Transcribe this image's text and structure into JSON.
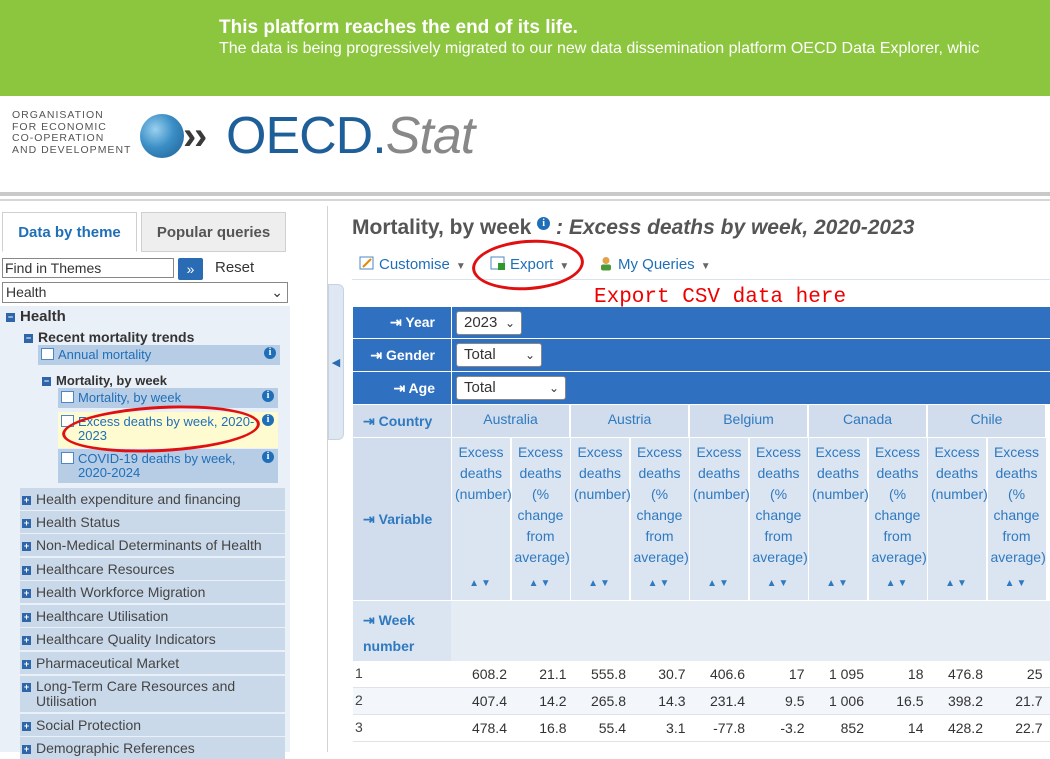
{
  "banner": {
    "title": "This platform reaches the end of its life.",
    "subtitle": "The data is being progressively migrated to our new data dissemination platform OECD Data Explorer, whic"
  },
  "header": {
    "org_lines": [
      "ORGANISATION",
      "FOR ECONOMIC",
      "CO-OPERATION",
      "AND DEVELOPMENT"
    ],
    "brand": "OECD",
    "brand_dot": ".",
    "brand_suffix": "Stat"
  },
  "left": {
    "tabs": [
      "Data by theme",
      "Popular queries"
    ],
    "find_value": "Find in Themes",
    "go_label": "»",
    "reset_label": "Reset",
    "theme_select": "Health",
    "tree": {
      "root": "Health",
      "group": "Recent mortality trends",
      "annual": "Annual mortality",
      "subgroup": "Mortality, by week",
      "items": [
        "Mortality, by week",
        "Excess deaths by week, 2020-2023",
        "COVID-19 deaths by week, 2020-2024"
      ],
      "categories": [
        "Health expenditure and financing",
        "Health Status",
        "Non-Medical Determinants of Health",
        "Healthcare Resources",
        "Health Workforce Migration",
        "Healthcare Utilisation",
        "Healthcare Quality Indicators",
        "Pharmaceutical Market",
        "Long-Term Care Resources and Utilisation",
        "Social Protection",
        "Demographic References"
      ]
    }
  },
  "main": {
    "title": "Mortality, by week",
    "subtitle": ": Excess deaths by week, 2020-2023",
    "toolbar": {
      "customise": "Customise",
      "export": "Export",
      "my_queries": "My Queries"
    },
    "annotation": "Export CSV data here",
    "dims": {
      "year_label": "Year",
      "year_value": "2023",
      "gender_label": "Gender",
      "gender_value": "Total",
      "age_label": "Age",
      "age_value": "Total",
      "country_label": "Country",
      "variable_label": "Variable",
      "week_label": "Week number"
    },
    "countries": [
      "Australia",
      "Austria",
      "Belgium",
      "Canada",
      "Chile"
    ],
    "variables": [
      "Excess deaths (number)",
      "Excess deaths (% change from average)"
    ],
    "rows": [
      {
        "week": "1",
        "values": [
          "608.2",
          "21.1",
          "555.8",
          "30.7",
          "406.6",
          "17",
          "1 095",
          "18",
          "476.8",
          "25"
        ]
      },
      {
        "week": "2",
        "values": [
          "407.4",
          "14.2",
          "265.8",
          "14.3",
          "231.4",
          "9.5",
          "1 006",
          "16.5",
          "398.2",
          "21.7"
        ]
      },
      {
        "week": "3",
        "values": [
          "478.4",
          "16.8",
          "55.4",
          "3.1",
          "-77.8",
          "-3.2",
          "852",
          "14",
          "428.2",
          "22.7"
        ]
      }
    ]
  },
  "colors": {
    "banner": "#8cc63f",
    "header_blue": "#2f70c0",
    "link": "#1f6fb8",
    "annotation": "#e00000"
  }
}
